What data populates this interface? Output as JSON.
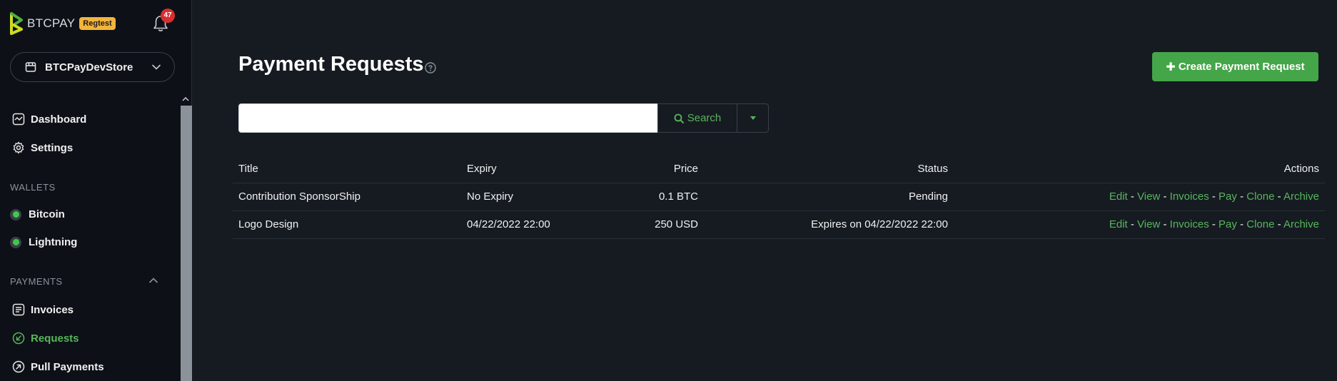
{
  "brand": {
    "name": "BTCPAY",
    "env_badge": "Regtest"
  },
  "notifications": {
    "count": "47"
  },
  "store": {
    "name": "BTCPayDevStore"
  },
  "nav": {
    "dashboard": "Dashboard",
    "settings": "Settings",
    "wallets_label": "WALLETS",
    "bitcoin": "Bitcoin",
    "lightning": "Lightning",
    "payments_label": "PAYMENTS",
    "invoices": "Invoices",
    "requests": "Requests",
    "pull_payments": "Pull Payments"
  },
  "page": {
    "title": "Payment Requests",
    "create_button": "Create Payment Request"
  },
  "search": {
    "value": "",
    "placeholder": "",
    "button": "Search"
  },
  "table": {
    "headers": {
      "title": "Title",
      "expiry": "Expiry",
      "price": "Price",
      "status": "Status",
      "actions": "Actions"
    },
    "rows": [
      {
        "title": "Contribution SponsorShip",
        "expiry": "No Expiry",
        "price": "0.1 BTC",
        "status": "Pending"
      },
      {
        "title": "Logo Design",
        "expiry": "04/22/2022 22:00",
        "price": "250 USD",
        "status": "Expires on 04/22/2022 22:00"
      }
    ],
    "actions": {
      "edit": "Edit",
      "view": "View",
      "invoices": "Invoices",
      "pay": "Pay",
      "clone": "Clone",
      "archive": "Archive",
      "separator": "-"
    }
  },
  "colors": {
    "accent": "#57b65a",
    "primary_button": "#44a648",
    "badge": "#f3b43c",
    "notification": "#d92e2e"
  },
  "icons": [
    "btcpay-logo-icon",
    "bell-icon",
    "store-icon",
    "chevron-down-icon",
    "dashboard-icon",
    "gear-icon",
    "invoice-icon",
    "requests-icon",
    "pull-payments-icon",
    "question-icon",
    "search-icon",
    "plus-icon",
    "caret-down-icon",
    "chevron-up-icon"
  ]
}
